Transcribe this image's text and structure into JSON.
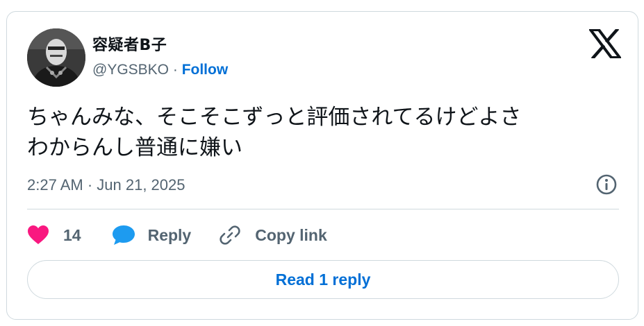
{
  "author": {
    "display_name": "容疑者B子",
    "handle": "@YGSBKO",
    "separator": " · ",
    "follow_label": "Follow"
  },
  "tweet": {
    "text_line1": "ちゃんみな、そこそこずっと評価されてるけどよさ",
    "text_line2": "わからんし普通に嫌い",
    "timestamp": "2:27 AM · Jun 21, 2025"
  },
  "actions": {
    "like_count": "14",
    "reply_label": "Reply",
    "copy_link_label": "Copy link",
    "read_reply_label": "Read 1 reply"
  },
  "icons": {
    "platform_logo": "x-logo-icon",
    "info": "info-icon",
    "like": "heart-icon",
    "reply": "speech-bubble-icon",
    "copy": "link-icon"
  },
  "colors": {
    "text": "#0f1419",
    "muted": "#536471",
    "link_blue": "#006fd6",
    "like_pink": "#f91880",
    "reply_blue": "#1d9bf0",
    "border": "#cfd9de"
  }
}
